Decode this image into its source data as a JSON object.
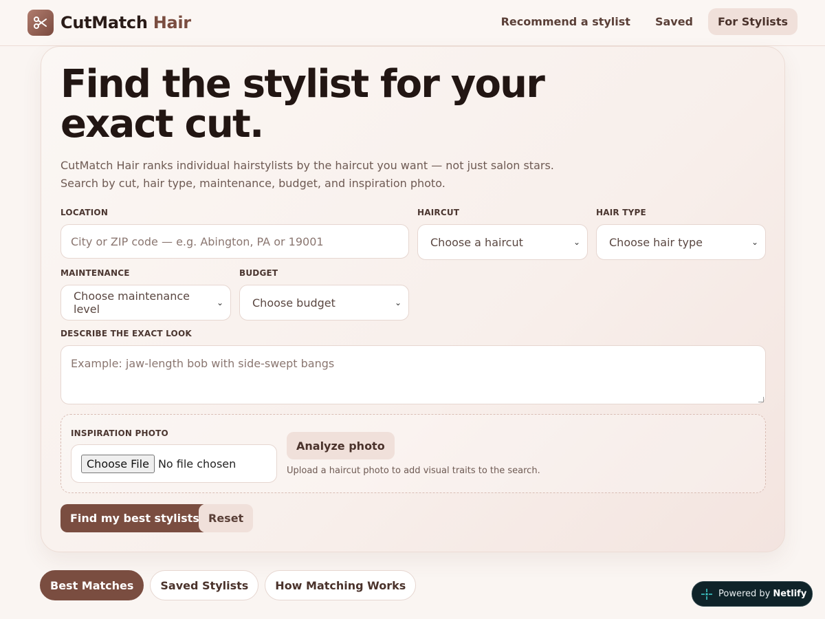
{
  "brand": {
    "name": "CutMatch",
    "accent": "Hair",
    "icon": "scissors-icon"
  },
  "nav": [
    {
      "label": "Recommend a stylist",
      "active": false
    },
    {
      "label": "Saved",
      "active": false
    },
    {
      "label": "For Stylists",
      "active": true
    }
  ],
  "hero": {
    "title": "Find the stylist for your exact cut.",
    "subtitle_line1": "CutMatch Hair ranks individual hairstylists by the haircut you want — not just salon stars.",
    "subtitle_line2": "Search by cut, hair type, maintenance, budget, and inspiration photo."
  },
  "form": {
    "location": {
      "label": "LOCATION",
      "placeholder": "City or ZIP code — e.g. Abington, PA or 19001"
    },
    "haircut": {
      "label": "HAIRCUT",
      "value": "Choose a haircut"
    },
    "hair_type": {
      "label": "HAIR TYPE",
      "value": "Choose hair type"
    },
    "maintenance": {
      "label": "MAINTENANCE",
      "value": "Choose maintenance level"
    },
    "budget": {
      "label": "BUDGET",
      "value": "Choose budget"
    },
    "look": {
      "label": "DESCRIBE THE EXACT LOOK",
      "placeholder": "Example: jaw-length bob with side-swept bangs"
    },
    "photo": {
      "label": "INSPIRATION PHOTO",
      "file_button": "Choose File",
      "file_status": "No file chosen",
      "analyze_label": "Analyze photo",
      "hint": "Upload a haircut photo to add visual traits to the search."
    },
    "submit_label": "Find my best stylists",
    "reset_label": "Reset"
  },
  "tabs": [
    {
      "label": "Best Matches",
      "active": true
    },
    {
      "label": "Saved Stylists",
      "active": false
    },
    {
      "label": "How Matching Works",
      "active": false
    }
  ],
  "badge": {
    "prefix": "Powered by",
    "name": "Netlify",
    "icon": "netlify-icon"
  },
  "colors": {
    "accent": "#7a4d40",
    "background": "#faf5f2",
    "chip": "#f0e0da"
  }
}
